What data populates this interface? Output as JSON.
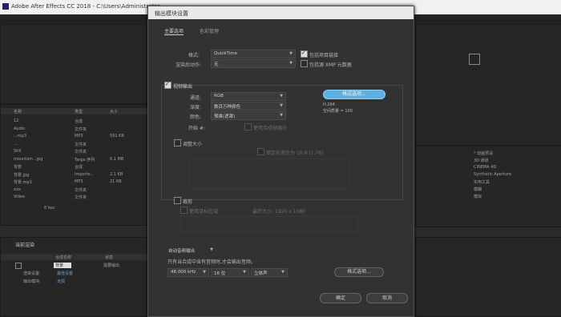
{
  "app": {
    "title": "Adobe After Effects CC 2018 - C:\\Users\\Administrator"
  },
  "project_panel": {
    "headers": {
      "name": "名称",
      "type": "类型",
      "size": "大小"
    },
    "rows": [
      {
        "name": "12",
        "type": "合成",
        "size": ""
      },
      {
        "name": "Audio",
        "type": "文件夹",
        "size": ""
      },
      {
        "name": "...mp3",
        "type": "MP3",
        "size": "591 KB"
      },
      {
        "name": "...",
        "type": "文件夹",
        "size": ""
      },
      {
        "name": "Still",
        "type": "文件夹",
        "size": ""
      },
      {
        "name": "mountain...jpg",
        "type": "Targa 序列",
        "size": "6.1 MB"
      },
      {
        "name": "背景",
        "type": "合成",
        "size": ""
      },
      {
        "name": "背景.jpg",
        "type": "Importe...",
        "size": "2.1 KB"
      },
      {
        "name": "背景.mp3",
        "type": "MP3",
        "size": "21 KB"
      },
      {
        "name": "xxx",
        "type": "文件夹",
        "size": ""
      },
      {
        "name": "Video",
        "type": "文件夹",
        "size": ""
      }
    ],
    "bpc": "8 bpc"
  },
  "render_queue": {
    "title": "当前渲染",
    "headers": {
      "comp": "合成名称",
      "status": "状态"
    },
    "item": {
      "name": "背景",
      "status": "需要输出"
    },
    "render_settings_label": "渲染设置:",
    "render_settings_value": "最佳设置",
    "output_module_label": "输出模块:",
    "output_module_value": "无损"
  },
  "effects_panel": {
    "items": [
      "* 动画预设",
      "3D 通道",
      "CINEMA 4D",
      "Synthetic Aperture",
      "实用工具",
      "模糊",
      "模拟"
    ]
  },
  "dialog": {
    "title": "输出模块设置",
    "tabs": [
      "主要选项",
      "色彩管理"
    ],
    "format_label": "格式:",
    "format_value": "QuickTime",
    "post_render_label": "渲染后动作:",
    "post_render_value": "无",
    "include_project_link": "包括项目链接",
    "include_xmp": "包括源 XMP 元数据",
    "video_output": "视频输出",
    "channels_label": "通道:",
    "channels_value": "RGB",
    "depth_label": "深度:",
    "depth_value": "数百万种颜色",
    "color_label": "颜色:",
    "color_value": "预乘(遮罩)",
    "start_label": "开始 #:",
    "use_comp_frame": "使用合成帧编号",
    "format_options_btn": "格式选项...",
    "codec": "H.264",
    "quality": "空间质量 = 100",
    "resize": "调整大小",
    "lock_aspect": "锁定长宽比为 16:9 (1.78)",
    "crop": "裁剪",
    "use_region": "使用目标区域",
    "final_size": "最终大小: 1920 x 1080",
    "auto_audio": "自动音频输出",
    "audio_note": "只有当合成中含有音频时,才会输出音频。",
    "sample_rate": "48.000 kHz",
    "bit_depth": "16 位",
    "channel_mode": "立体声",
    "audio_format_btn": "格式选项...",
    "ok": "确定",
    "cancel": "取消"
  }
}
